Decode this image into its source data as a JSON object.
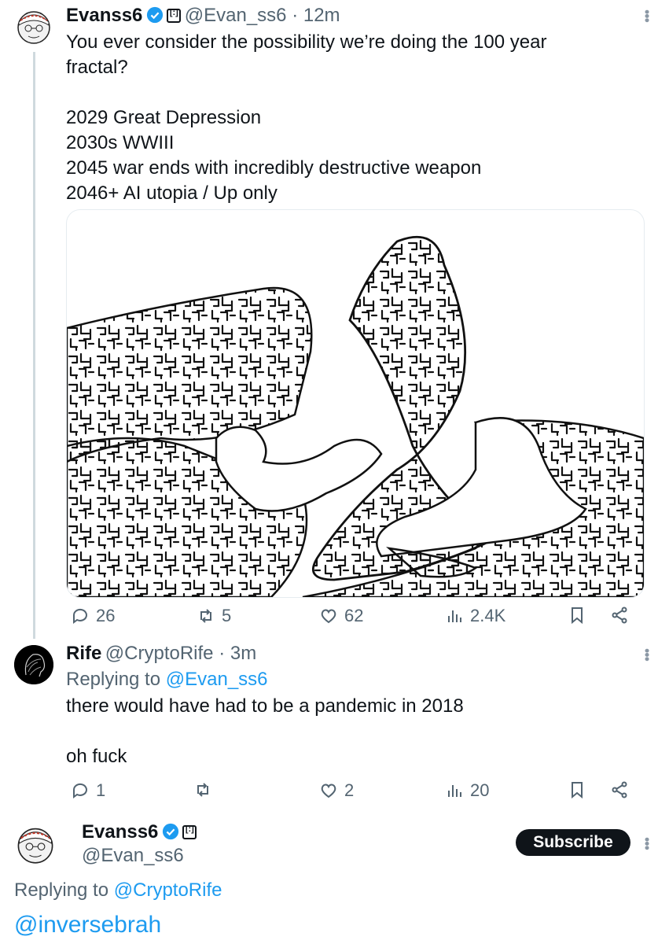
{
  "tweet1": {
    "name": "Evanss6",
    "handle_time": "@Evan_ss6 · 12m",
    "body": "You ever consider the possibility we’re doing the 100 year\nfractal?\n\n2029 Great Depression\n2030s WWIII\n2045 war ends with incredibly destructive weapon\n2046+ AI utopia / Up only",
    "replies": "26",
    "reposts": "5",
    "likes": "62",
    "views": "2.4K"
  },
  "tweet2": {
    "name": "Rife",
    "handle_time": "@CryptoRife · 3m",
    "replying_prefix": "Replying to ",
    "replying_handle": "@Evan_ss6",
    "body": "there would have had to be a pandemic in 2018\n\noh fuck",
    "replies": "1",
    "likes": "2",
    "views": "20"
  },
  "compose": {
    "name": "Evanss6",
    "handle": "@Evan_ss6",
    "subscribe_label": "Subscribe",
    "replying_prefix": "Replying to ",
    "replying_handle": "@CryptoRife",
    "draft_text": "@inversebrah"
  },
  "colors": {
    "link": "#1d9bf0",
    "muted": "#536471",
    "text": "#0f1419",
    "verified": "#1d9bf0"
  }
}
